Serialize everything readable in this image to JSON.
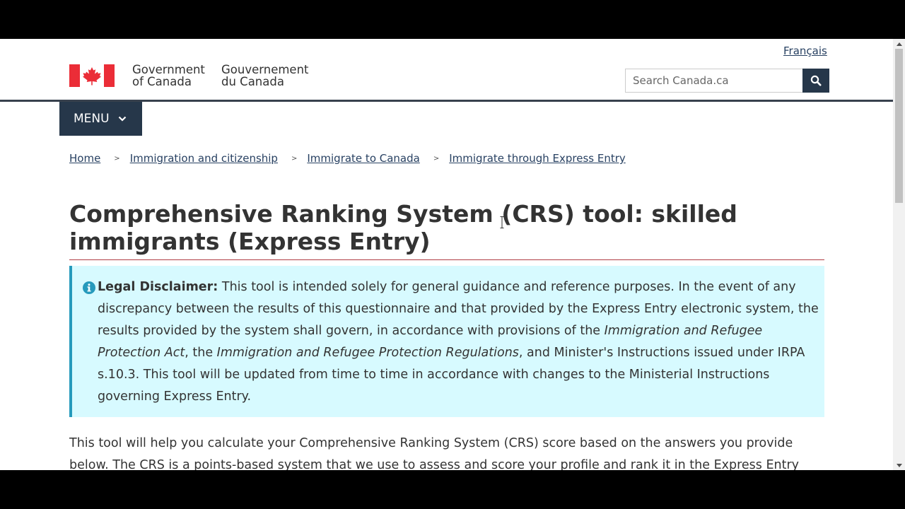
{
  "header": {
    "language_link": "Français",
    "signature_en": [
      "Government",
      "of Canada"
    ],
    "signature_fr": [
      "Gouvernement",
      "du Canada"
    ],
    "search_placeholder": "Search Canada.ca",
    "search_icon": "magnifier-icon",
    "menu_label": "MENU",
    "brand_red": "#eb2d37",
    "navy": "#26374a"
  },
  "breadcrumb": [
    "Home",
    "Immigration and citizenship",
    "Immigrate to Canada",
    "Immigrate through Express Entry"
  ],
  "breadcrumb_separator": ">",
  "page_title": "Comprehensive Ranking System (CRS) tool: skilled immigrants (Express Entry)",
  "alert": {
    "icon": "info-icon",
    "label": "Legal Disclaimer:",
    "text_1": " This tool is intended solely for general guidance and reference purposes. In the event of any discrepancy between the results of this questionnaire and that provided by the Express Entry electronic system, the results provided by the system shall govern, in accordance with provisions of the ",
    "act": "Immigration and Refugee Protection Act",
    "text_2": ", the ",
    "regulations": "Immigration and Refugee Protection Regulations",
    "text_3": ", and Minister's Instructions issued under IRPA s.10.3. This tool will be updated from time to time in accordance with changes to the Ministerial Instructions governing Express Entry.",
    "background": "#d7faff",
    "border": "#269abc"
  },
  "intro": "This tool will help you calculate your Comprehensive Ranking System (CRS) score based on the answers you provide below. The CRS is a points-based system that we use to assess and score your profile and rank it in the Express Entry"
}
